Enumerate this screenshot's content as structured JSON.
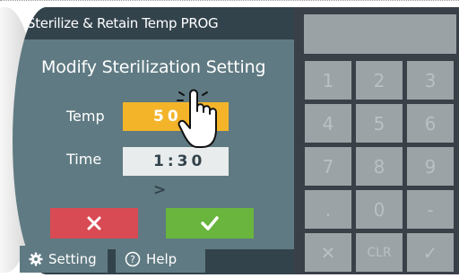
{
  "screen": {
    "title": "Sterilize & Retain Temp PROG",
    "heading": "Modify Sterilization Setting",
    "temp_label": "Temp",
    "temp_value": "50 >",
    "time_label": "Time",
    "time_value": "1:30 >",
    "cancel_icon": "close-icon",
    "ok_icon": "check-icon"
  },
  "bottom": {
    "setting_label": "Setting",
    "help_label": "Help",
    "help_icon_text": "?"
  },
  "keypad": {
    "keys": [
      "1",
      "2",
      "3",
      "4",
      "5",
      "6",
      "7",
      "8",
      "9",
      ".",
      "0",
      "-",
      "✕",
      "CLR",
      "✓"
    ]
  },
  "colors": {
    "panel": "#5f7a82",
    "titlebar": "#33434c",
    "temp_field": "#f3b42a",
    "cancel": "#d94b54",
    "ok": "#69b53e",
    "keypad_bg": "#3a4047",
    "key": "#9ba3a7"
  }
}
